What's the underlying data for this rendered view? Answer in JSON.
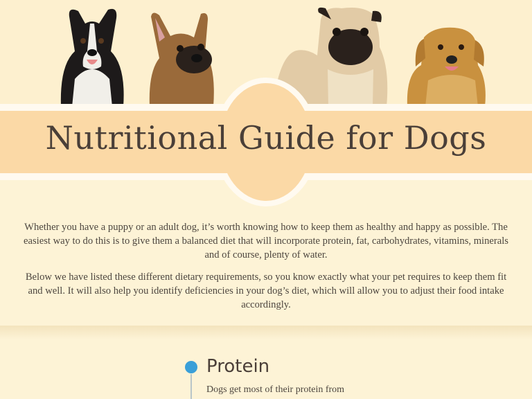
{
  "title": "Nutritional Guide for Dogs",
  "intro": {
    "paragraph1": "Whether you have a puppy or an adult dog, it’s worth knowing how to keep them as healthy and happy as possible. The easiest way to do this is to give them a balanced diet that will incorporate protein, fat, carbohydrates, vitamins, minerals and of course, plenty of water.",
    "paragraph2": "Below we have listed these different dietary requirements, so you know exactly what your pet requires to keep them fit and well. It will also help you identify deficiencies in your dog’s diet, which will allow you to adjust their food intake accordingly."
  },
  "sections": [
    {
      "title": "Protein",
      "text": "Dogs get most of their protein from"
    }
  ],
  "colors": {
    "background": "#fdf3d6",
    "banner": "#fbd9a6",
    "title": "#4a3f38",
    "bullet": "#3a9fd8"
  },
  "images": [
    "border-collie-dog",
    "french-bulldog-dog",
    "pug-dog",
    "golden-retriever-dog"
  ]
}
